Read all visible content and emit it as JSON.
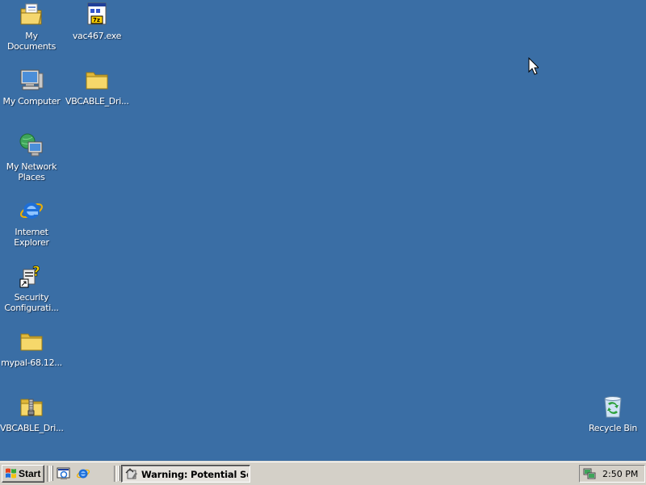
{
  "desktop": {
    "background": "#3a6ea5",
    "icons": [
      {
        "label": "My Documents",
        "icon": "my-documents-icon"
      },
      {
        "label": "vac467.exe",
        "icon": "installer-icon"
      },
      {
        "label": "My Computer",
        "icon": "my-computer-icon"
      },
      {
        "label": "VBCABLE_Dri...",
        "icon": "folder-icon"
      },
      {
        "label": "My Network Places",
        "icon": "network-places-icon"
      },
      {
        "label": "Internet Explorer",
        "icon": "internet-explorer-icon"
      },
      {
        "label": "Security Configurati...",
        "icon": "security-config-icon"
      },
      {
        "label": "mypal-68.12...",
        "icon": "folder-icon"
      },
      {
        "label": "VBCABLE_Dri...",
        "icon": "zip-folder-icon"
      },
      {
        "label": "Recycle Bin",
        "icon": "recycle-bin-icon"
      }
    ]
  },
  "taskbar": {
    "start_label": "Start",
    "quick_launch": [
      "show-desktop-icon",
      "internet-explorer-icon"
    ],
    "task_label": "Warning: Potential Se...",
    "clock": "2:50 PM"
  }
}
